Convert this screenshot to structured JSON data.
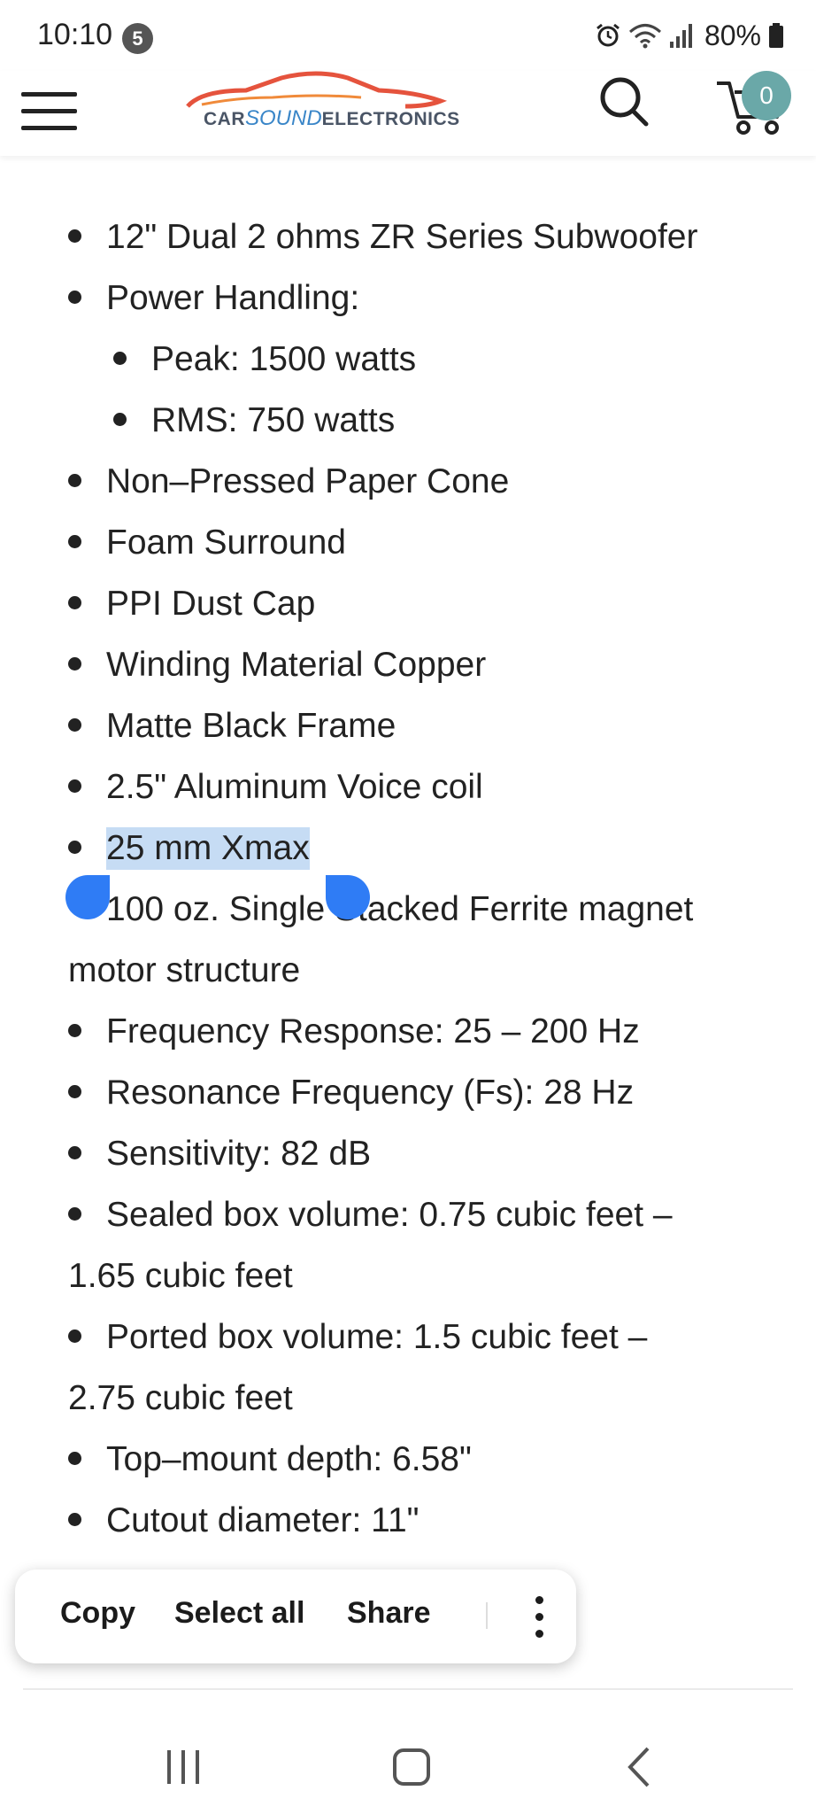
{
  "status_bar": {
    "time": "10:10",
    "notification_count": "5",
    "battery": "80%"
  },
  "header": {
    "logo": {
      "brand_car": "CAR",
      "brand_sound": "SOUND",
      "brand_rest": "ELECTRONICS"
    },
    "cart_count": "0",
    "icons": [
      "hamburger-menu-icon",
      "search-icon",
      "cart-icon"
    ]
  },
  "specs": [
    {
      "text": "12\" Dual 2 ohms ZR Series Subwoofer"
    },
    {
      "text": "Power Handling:"
    },
    {
      "text": "Peak: 1500 watts"
    },
    {
      "text": "RMS: 750 watts"
    },
    {
      "text": "Non–Pressed Paper Cone"
    },
    {
      "text": "Foam Surround"
    },
    {
      "text": "PPI Dust Cap"
    },
    {
      "text": "Winding Material Copper"
    },
    {
      "text": "Matte Black Frame"
    },
    {
      "text": "2.5\" Aluminum Voice coil"
    },
    {
      "text": "25 mm Xmax"
    },
    {
      "text": "100 oz. Single Stacked Ferrite magnet"
    },
    {
      "text": "motor structure"
    },
    {
      "text": "Frequency Response: 25 – 200 Hz"
    },
    {
      "text": "Resonance Frequency (Fs): 28 Hz"
    },
    {
      "text": "Sensitivity: 82 dB"
    },
    {
      "text": "Sealed box volume: 0.75 cubic feet –"
    },
    {
      "text": "1.65 cubic feet"
    },
    {
      "text": "Ported box volume: 1.5 cubic feet –"
    },
    {
      "text": "2.75 cubic feet"
    },
    {
      "text": "Top–mount depth: 6.58\""
    },
    {
      "text": "Cutout diameter: 11\""
    }
  ],
  "context_menu": {
    "copy": "Copy",
    "select_all": "Select all",
    "share": "Share"
  },
  "colors": {
    "selection_highlight": "#c6dcf4",
    "selection_handle": "#2f7cf5",
    "cart_badge": "#6aa8a8",
    "logo_car": "#e5533d"
  }
}
